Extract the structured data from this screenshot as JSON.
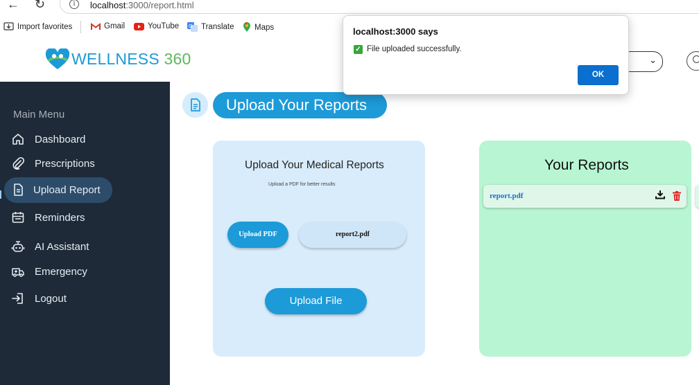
{
  "browser": {
    "url_host": "localhost",
    "url_path": ":3000/report.html",
    "favorites": [
      {
        "label": "Import favorites",
        "icon": "import-icon"
      },
      {
        "label": "Gmail",
        "icon": "gmail-icon"
      },
      {
        "label": "YouTube",
        "icon": "youtube-icon"
      },
      {
        "label": "Translate",
        "icon": "translate-icon"
      },
      {
        "label": "Maps",
        "icon": "maps-icon"
      }
    ]
  },
  "header": {
    "logo_word": "WELLNESS",
    "logo_number": "360"
  },
  "sidebar": {
    "title": "Main Menu",
    "items": [
      {
        "label": "Dashboard",
        "icon": "home-icon",
        "active": false
      },
      {
        "label": "Prescriptions",
        "icon": "paperclip-icon",
        "active": false
      },
      {
        "label": "Upload Report",
        "icon": "document-icon",
        "active": true
      },
      {
        "label": "Reminders",
        "icon": "calendar-icon",
        "active": false
      },
      {
        "label": "AI Assistant",
        "icon": "robot-icon",
        "active": false
      },
      {
        "label": "Emergency",
        "icon": "ambulance-icon",
        "active": false
      },
      {
        "label": "Logout",
        "icon": "logout-icon",
        "active": false
      }
    ]
  },
  "main": {
    "page_title": "Upload Your Reports",
    "upload_card": {
      "heading": "Upload Your Medical Reports",
      "hint": "Upload a PDF for better results",
      "choose_button": "Upload PDF",
      "selected_file": "report2.pdf",
      "submit_button": "Upload File"
    },
    "reports_card": {
      "heading": "Your Reports",
      "files": [
        "report.pdf"
      ]
    }
  },
  "dialog": {
    "title": "localhost:3000 says",
    "message": "File uploaded successfully.",
    "ok_label": "OK"
  },
  "colors": {
    "primary": "#1d9ad8",
    "sidebar_bg": "#1e2a38",
    "sidebar_active": "#2c4c6a",
    "upload_card_bg": "#d9ecfb",
    "reports_card_bg": "#b8f5d2",
    "delete_red": "#e02424",
    "dialog_ok": "#0a6fcf"
  }
}
